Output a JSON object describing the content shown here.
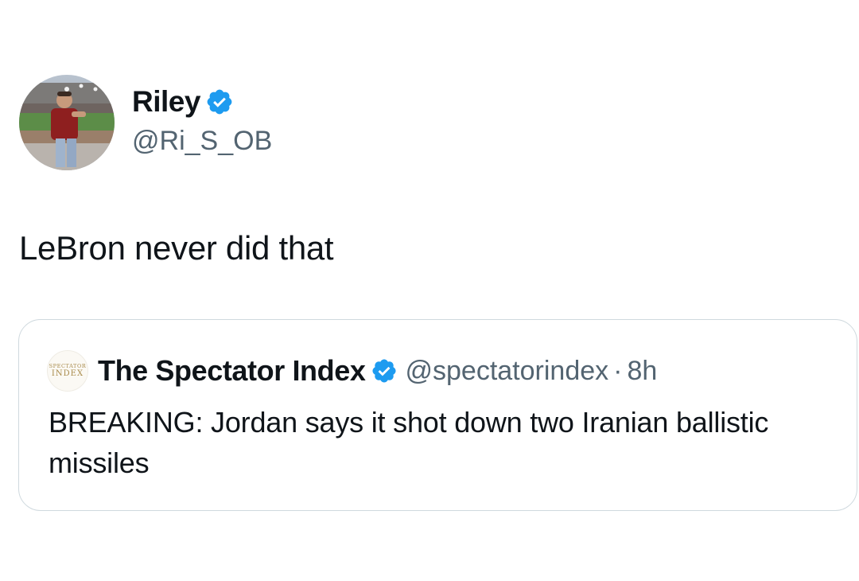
{
  "tweet": {
    "author": {
      "display_name": "Riley",
      "handle": "@Ri_S_OB",
      "verified_icon": "verified-badge-icon"
    },
    "text": "LeBron never did that"
  },
  "quoted_tweet": {
    "author": {
      "display_name": "The Spectator Index",
      "handle": "@spectatorindex",
      "avatar_line1": "SPECTATOR",
      "avatar_line2": "INDEX",
      "verified_icon": "verified-badge-icon"
    },
    "separator": "·",
    "time": "8h",
    "text": "BREAKING: Jordan says it shot down two Iranian ballistic missiles"
  },
  "colors": {
    "verified": "#1d9bf0",
    "text_primary": "#0f1419",
    "text_secondary": "#536471",
    "card_border": "#cfd9de"
  }
}
